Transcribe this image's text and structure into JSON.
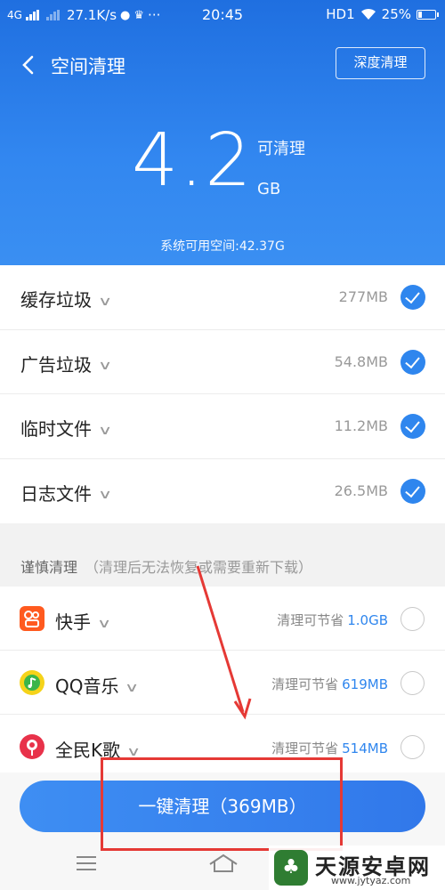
{
  "status_bar": {
    "network": "4G",
    "speed": "27.1K/s",
    "time": "20:45",
    "hd": "HD1",
    "battery_percent": "25%",
    "battery_level": 0.25
  },
  "header": {
    "back_glyph": "‹",
    "title": "空间清理",
    "deep_clean_label": "深度清理"
  },
  "summary": {
    "amount": "4.2",
    "label": "可清理",
    "unit": "GB",
    "available": "系统可用空间:42.37G"
  },
  "junk_items": [
    {
      "name": "缓存垃圾",
      "size": "277MB",
      "checked": true
    },
    {
      "name": "广告垃圾",
      "size": "54.8MB",
      "checked": true
    },
    {
      "name": "临时文件",
      "size": "11.2MB",
      "checked": true
    },
    {
      "name": "日志文件",
      "size": "26.5MB",
      "checked": true
    }
  ],
  "careful_section": {
    "title": "谨慎清理",
    "note": "（清理后无法恢复或需要重新下载）"
  },
  "apps": [
    {
      "name": "快手",
      "save_prefix": "清理可节省",
      "save_size": "1.0GB",
      "icon": "kuaishou-icon",
      "color": "#ff5a1f"
    },
    {
      "name": "QQ音乐",
      "save_prefix": "清理可节省",
      "save_size": "619MB",
      "icon": "qqmusic-icon",
      "color": "#f5d31a"
    },
    {
      "name": "全民K歌",
      "save_prefix": "清理可节省",
      "save_size": "514MB",
      "icon": "quanmin-kge-icon",
      "color": "#e8324a"
    }
  ],
  "action": {
    "clean_label": "一键清理（369MB）"
  },
  "watermark": {
    "text": "天源安卓网",
    "url": "www.jytyaz.com"
  },
  "colors": {
    "accent": "#2f86ee",
    "annotation": "#e53935"
  }
}
